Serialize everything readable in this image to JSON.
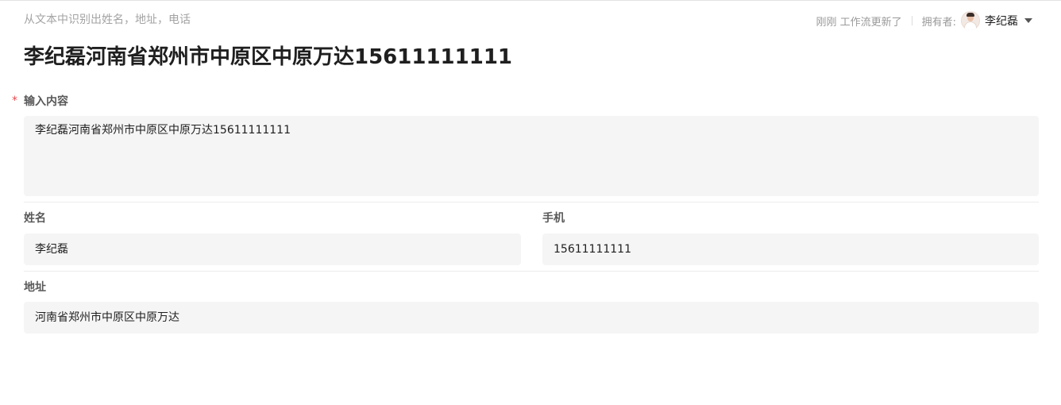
{
  "header": {
    "breadcrumb": "从文本中识别出姓名，地址，电话",
    "updated_text": "刚刚 工作流更新了",
    "owner_label": "拥有者:",
    "owner_name": "李纪磊",
    "avatar_icon": "avatar-user-icon",
    "dropdown_icon": "caret-down-icon"
  },
  "page": {
    "title": "李纪磊河南省郑州市中原区中原万达15611111111"
  },
  "form": {
    "input": {
      "required_mark": "*",
      "label": "输入内容",
      "value": "李纪磊河南省郑州市中原区中原万达15611111111"
    },
    "name": {
      "label": "姓名",
      "value": "李纪磊"
    },
    "phone": {
      "label": "手机",
      "value": "15611111111"
    },
    "address": {
      "label": "地址",
      "value": "河南省郑州市中原区中原万达"
    }
  },
  "colors": {
    "required": "#e5484d",
    "field_background": "#f5f5f5",
    "muted_text": "#9a9a9a"
  }
}
